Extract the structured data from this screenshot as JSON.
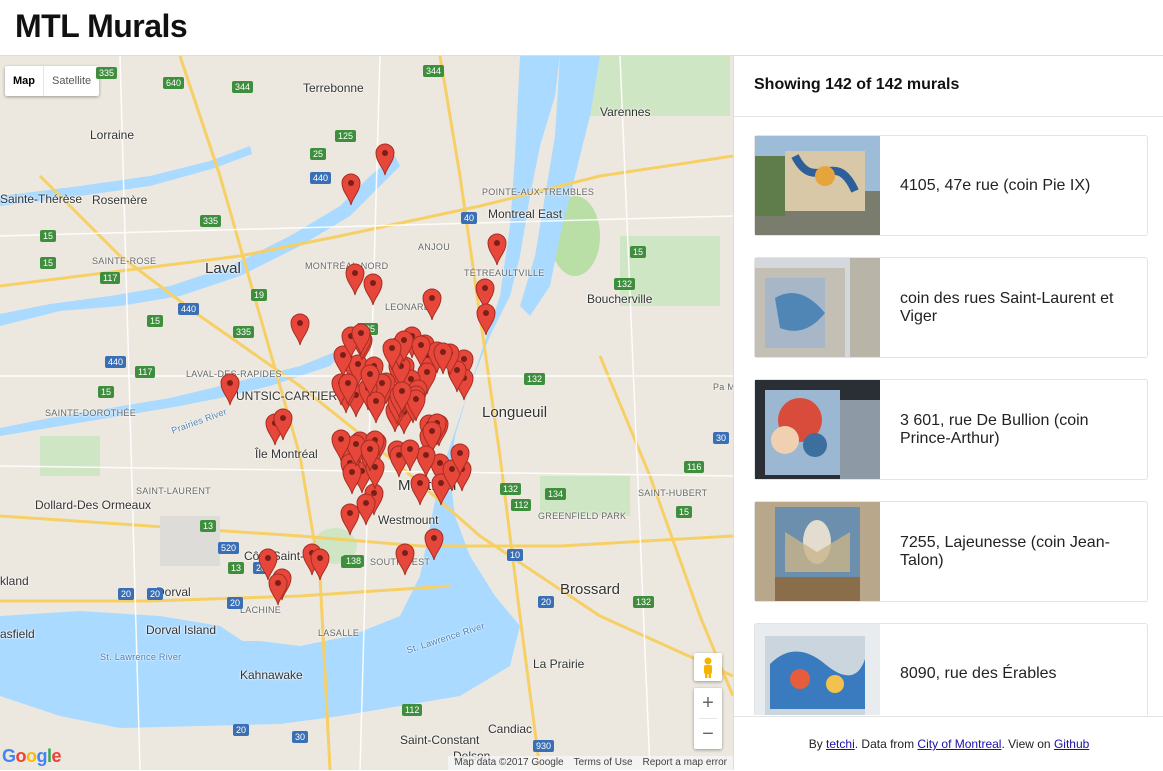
{
  "app": {
    "title": "MTL Murals"
  },
  "map": {
    "type_buttons": [
      "Map",
      "Satellite"
    ],
    "zoom_in": "+",
    "zoom_out": "−",
    "google_logo": "Google",
    "attribution": [
      "Map data ©2017 Google",
      "Terms of Use",
      "Report a map error"
    ],
    "places": [
      "Terrebonne",
      "Lorraine",
      "Rosemère",
      "Sainte-Thérèse",
      "SAINTE-ROSE",
      "Laval",
      "MONTRÉAL-NORD",
      "LEONARD",
      "ANJOU",
      "Montreal East",
      "POINTE-AUX-TREMBLES",
      "Varennes",
      "TÉTREAULTVILLE",
      "Boucherville",
      "LAVAL-DES-RAPIDES",
      "UNTSIC-CARTIERV",
      "SAINTE-DOROTHÉE",
      "Longueuil",
      "Île Montréal",
      "SAINT-LAURENT",
      "Montreal",
      "Dollard-Des Ormeaux",
      "Westmount",
      "GREENFIELD PARK",
      "SAINT-HUBERT",
      "Côte Saint-Luc",
      "SOUTHWEST",
      "kland",
      "Dorval",
      "Brossard",
      "Dorval Island",
      "LACHINE",
      "LASALLE",
      "asfield",
      "La Prairie",
      "Kahnawake",
      "Candiac",
      "Saint-Constant",
      "Delson",
      "St. Lawrence River",
      "St. Lawrence River",
      "Prairies River",
      "Pa M"
    ],
    "road_shields": [
      "335",
      "640",
      "344",
      "344",
      "25",
      "125",
      "440",
      "40",
      "335",
      "15",
      "117",
      "15",
      "19",
      "440",
      "15",
      "335",
      "440",
      "117",
      "15",
      "13",
      "125",
      "132",
      "138",
      "20",
      "20",
      "520",
      "13",
      "20",
      "15",
      "132",
      "30",
      "116",
      "132",
      "112",
      "10",
      "134",
      "15",
      "132",
      "112",
      "138",
      "930",
      "20",
      "30",
      "20",
      "20"
    ],
    "colors": {
      "pin": "#e7473a",
      "water": "#aadaff",
      "park": "#c5e8c5",
      "land": "#ece8df"
    },
    "markers_count": 142
  },
  "sidebar": {
    "count_text": "Showing 142 of 142 murals",
    "murals": [
      {
        "address": "4105, 47e rue (coin Pie IX)"
      },
      {
        "address": "coin des rues Saint-Laurent et Viger"
      },
      {
        "address": "3 601, rue De Bullion (coin Prince-Arthur)"
      },
      {
        "address": "7255, Lajeunesse (coin Jean-Talon)"
      },
      {
        "address": "8090, rue des Érables"
      }
    ],
    "footer": {
      "by": "By ",
      "author": "tetchi",
      "data_from": ". Data from ",
      "source": "City of Montreal",
      "view_on": ". View on ",
      "repo": "Github"
    }
  }
}
